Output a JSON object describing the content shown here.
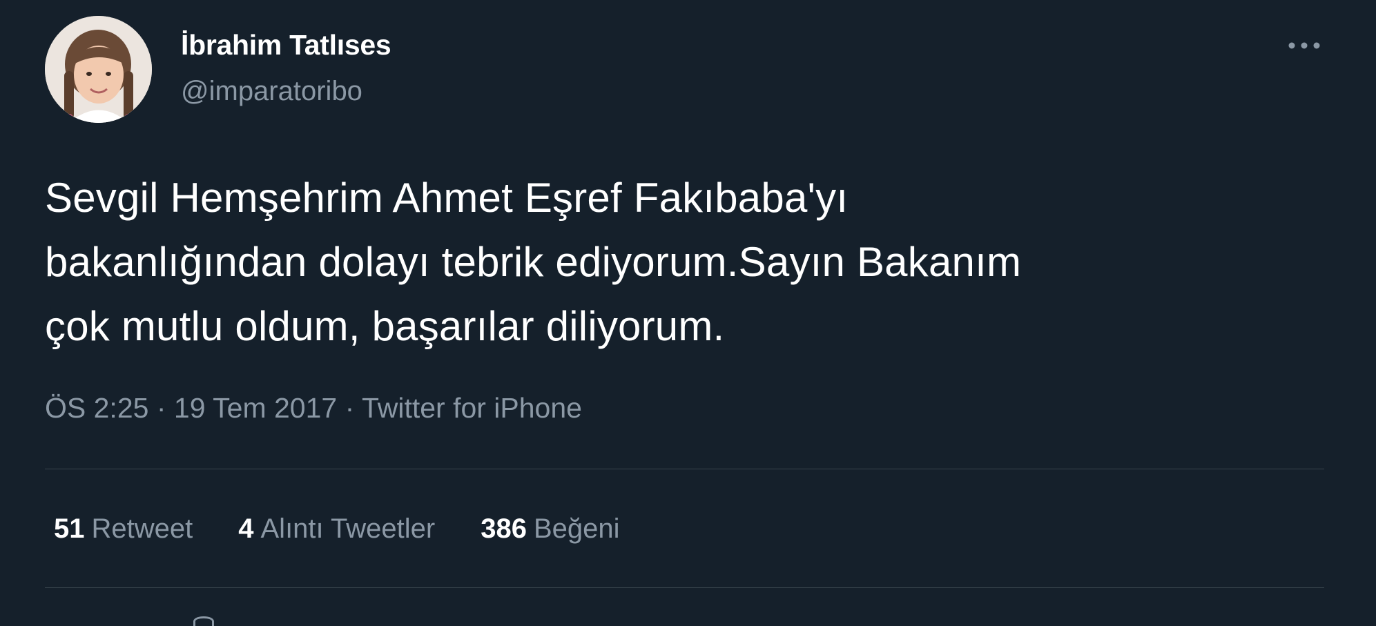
{
  "tweet": {
    "author": {
      "name": "İbrahim Tatlıses",
      "handle": "@imparatoribo",
      "avatar_icon": "profile-photo-child"
    },
    "more_icon": "more-horizontal-icon",
    "text": "Sevgil Hemşehrim Ahmet Eşref Fakıbaba'yı\nbakanlığından dolayı tebrik ediyorum.Sayın Bakanım\nçok mutlu oldum, başarılar diliyorum.",
    "meta": {
      "time": "ÖS 2:25",
      "separator": "·",
      "date": "19 Tem 2017",
      "source": "Twitter for iPhone"
    },
    "stats": {
      "retweets": {
        "count": "51",
        "label": "Retweet"
      },
      "quotes": {
        "count": "4",
        "label": "Alıntı Tweetler"
      },
      "likes": {
        "count": "386",
        "label": "Beğeni"
      }
    }
  },
  "colors": {
    "background": "#15202b",
    "primary_text": "#ffffff",
    "secondary_text": "#8b98a5",
    "divider": "#38444d"
  }
}
